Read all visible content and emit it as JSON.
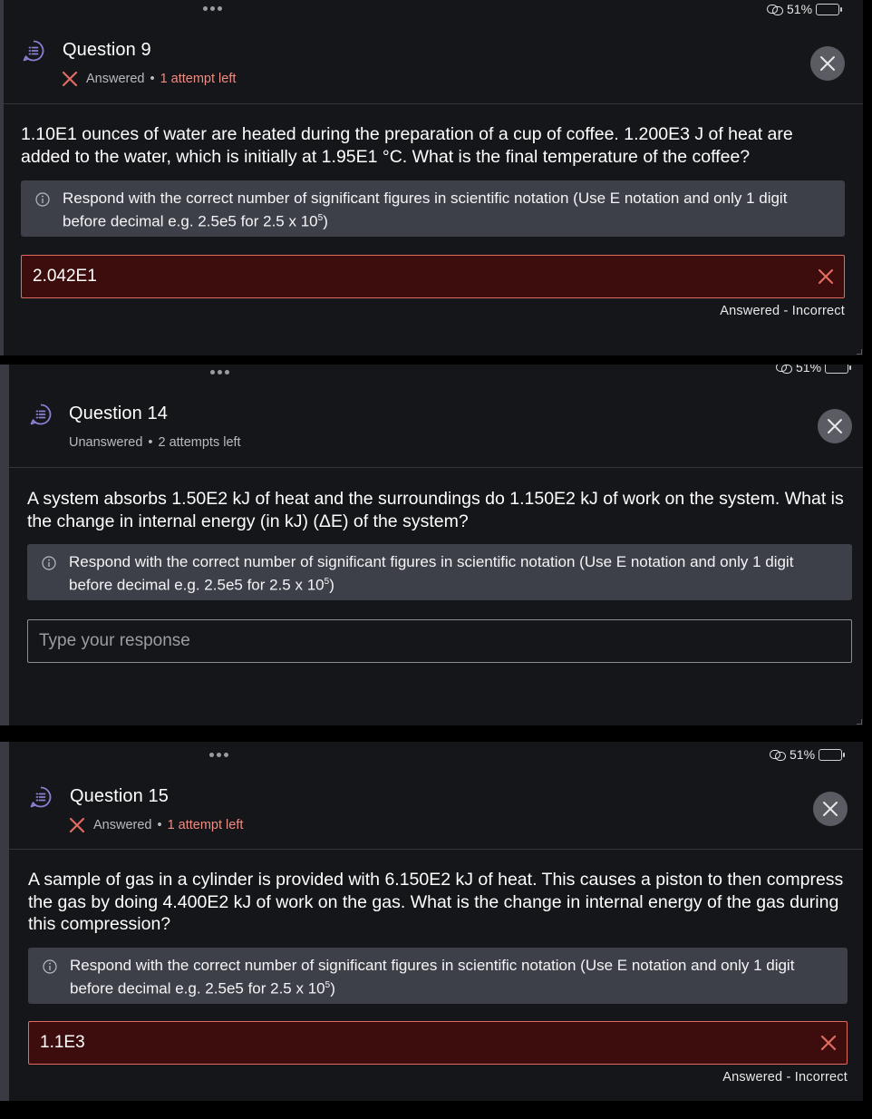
{
  "status_bar": {
    "battery_text": "51%",
    "battery_partial_text": "51%"
  },
  "colors": {
    "background": "#151619",
    "accent_purple": "#8b7fd6",
    "incorrect_red": "#e06b60",
    "hint_bg": "#3e4049"
  },
  "questions": [
    {
      "title": "Question 9",
      "status": "Answered",
      "separator": "•",
      "attempts": "1 attempt left",
      "text": "1.10E1 ounces of water are heated during the preparation of a cup of coffee. 1.200E3 J of heat are added to the water, which is initially at 1.95E1 °C. What is the final temperature of the coffee?",
      "hint_main": "Respond with the correct number of significant figures in scientific notation (Use E notation and only 1 digit before decimal e.g. 2.5e5 for 2.5 x 10",
      "hint_sup": "5",
      "hint_end": ")",
      "answer": "2.042E1",
      "result": "Answered - Incorrect",
      "icons": {
        "question": "chat-list-icon",
        "status": "x-mark-icon",
        "close": "close-icon",
        "info": "info-icon"
      }
    },
    {
      "title": "Question 14",
      "status": "Unanswered",
      "separator": "•",
      "attempts": "2 attempts left",
      "text": "A system absorbs 1.50E2 kJ of heat and the surroundings do 1.150E2 kJ of work on the system. What is the change in internal energy (in kJ) (ΔE) of the system?",
      "hint_main": "Respond with the correct number of significant figures in scientific notation (Use E notation and only 1 digit before decimal e.g. 2.5e5 for 2.5 x 10",
      "hint_sup": "5",
      "hint_end": ")",
      "placeholder": "Type your response"
    },
    {
      "title": "Question 15",
      "status": "Answered",
      "separator": "•",
      "attempts": "1 attempt left",
      "text": "A sample of gas in a cylinder is provided with 6.150E2 kJ of heat. This causes a piston to then compress the gas by doing 4.400E2 kJ of work on the gas. What is the change in internal energy of the gas during this compression?",
      "hint_main": "Respond with the correct number of significant figures in scientific notation (Use E notation and only 1 digit before decimal e.g. 2.5e5 for 2.5 x 10",
      "hint_sup": "5",
      "hint_end": ")",
      "answer": "1.1E3",
      "result": "Answered - Incorrect"
    }
  ]
}
